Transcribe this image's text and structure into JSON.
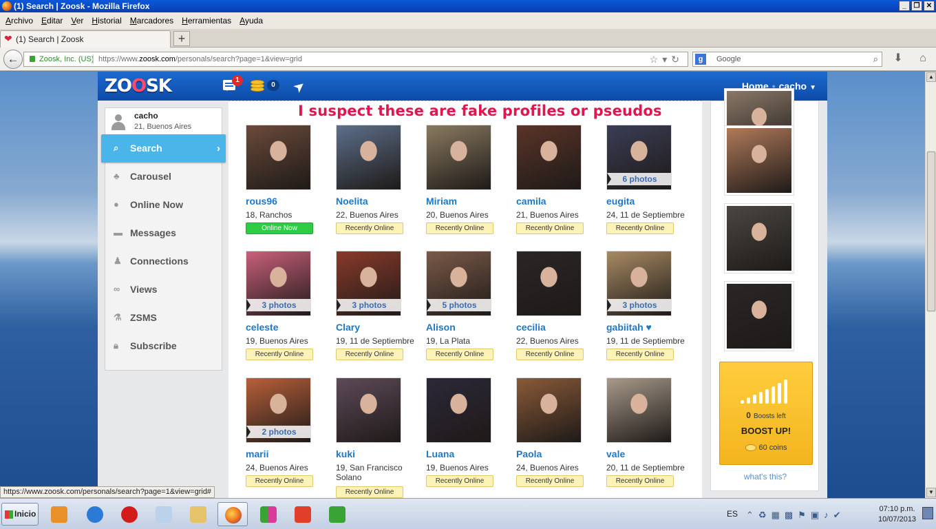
{
  "window": {
    "title": "(1) Search | Zoosk - Mozilla Firefox"
  },
  "menu": [
    "Archivo",
    "Editar",
    "Ver",
    "Historial",
    "Marcadores",
    "Herramientas",
    "Ayuda"
  ],
  "tab": {
    "title": "(1) Search | Zoosk",
    "new_tab": "+"
  },
  "urlbar": {
    "identity": "Zoosk, Inc. (US)",
    "url_prefix": "https://www.",
    "url_domain": "zoosk.com",
    "url_path": "/personals/search?page=1&view=grid"
  },
  "searchbar": {
    "engine": "g",
    "placeholder": "Google"
  },
  "header": {
    "logo_a": "Z",
    "logo_o1": "O",
    "logo_o2": "O",
    "logo_b": "SK",
    "message_count": "1",
    "coin_count": "0",
    "home": "Home",
    "user": "cacho"
  },
  "sidebar": {
    "user_name": "cacho",
    "user_location": "21, Buenos Aires",
    "items": [
      {
        "label": "Search",
        "icon": "search-icon",
        "active": true
      },
      {
        "label": "Carousel",
        "icon": "carousel-icon"
      },
      {
        "label": "Online Now",
        "icon": "online-now-icon"
      },
      {
        "label": "Messages",
        "icon": "messages-icon"
      },
      {
        "label": "Connections",
        "icon": "connections-icon"
      },
      {
        "label": "Views",
        "icon": "views-icon"
      },
      {
        "label": "ZSMS",
        "icon": "zsms-icon"
      },
      {
        "label": "Subscribe",
        "icon": "lock-icon"
      }
    ]
  },
  "annotation": "I suspect these are fake profiles or pseudos",
  "profiles": [
    {
      "name": "rous96",
      "location": "18, Ranchos",
      "status": "Online Now",
      "online": true,
      "photos": "",
      "color": "#6b4a3a"
    },
    {
      "name": "Noelita",
      "location": "22, Buenos Aires",
      "status": "Recently Online",
      "photos": "",
      "color": "#5d6f8a"
    },
    {
      "name": "Miriam",
      "location": "20, Buenos Aires",
      "status": "Recently Online",
      "photos": "",
      "color": "#8a7a60"
    },
    {
      "name": "camila",
      "location": "21, Buenos Aires",
      "status": "Recently Online",
      "photos": "",
      "color": "#5a3428"
    },
    {
      "name": "eugita",
      "location": "24, 11 de Septiembre",
      "status": "Recently Online",
      "photos": "6 photos",
      "color": "#3a3d55"
    },
    {
      "name": "celeste",
      "location": "19, Buenos Aires",
      "status": "Recently Online",
      "photos": "3 photos",
      "color": "#c9607a"
    },
    {
      "name": "Clary",
      "location": "19, 11 de Septiembre",
      "status": "Recently Online",
      "photos": "3 photos",
      "color": "#8a3a2a"
    },
    {
      "name": "Alison",
      "location": "19, La Plata",
      "status": "Recently Online",
      "photos": "5 photos",
      "color": "#7a5a48"
    },
    {
      "name": "cecilia",
      "location": "22, Buenos Aires",
      "status": "Recently Online",
      "photos": "",
      "color": "#2a2626"
    },
    {
      "name": "gabiitah ♥",
      "location": "19, 11 de Septiembre",
      "status": "Recently Online",
      "photos": "3 photos",
      "color": "#a88a62"
    },
    {
      "name": "marii",
      "location": "24, Buenos Aires",
      "status": "Recently Online",
      "photos": "2 photos",
      "color": "#b8603a"
    },
    {
      "name": "kuki",
      "location": "19, San Francisco Solano",
      "status": "Recently Online",
      "photos": "",
      "color": "#5e4a58"
    },
    {
      "name": "Luana",
      "location": "19, Buenos Aires",
      "status": "Recently Online",
      "photos": "",
      "color": "#2c2838"
    },
    {
      "name": "Paola",
      "location": "24, Buenos Aires",
      "status": "Recently Online",
      "photos": "",
      "color": "#8a5a38"
    },
    {
      "name": "vale",
      "location": "20, 11 de Septiembre",
      "status": "Recently Online",
      "photos": "",
      "color": "#a89a8a"
    }
  ],
  "right_photos": [
    {
      "color": "#8a7868"
    },
    {
      "color": "#b07a5a"
    },
    {
      "color": "#4a4640"
    },
    {
      "color": "#2a2626"
    }
  ],
  "boost": {
    "count": "0",
    "count_label": "Boosts left",
    "title": "BOOST UP!",
    "coins": "60 coins",
    "help": "what's this?"
  },
  "status_url": "https://www.zoosk.com/personals/search?page=1&view=grid#",
  "taskbar": {
    "start": "Inicio",
    "language": "ES",
    "time": "07:10 p.m.",
    "date": "10/07/2013"
  }
}
